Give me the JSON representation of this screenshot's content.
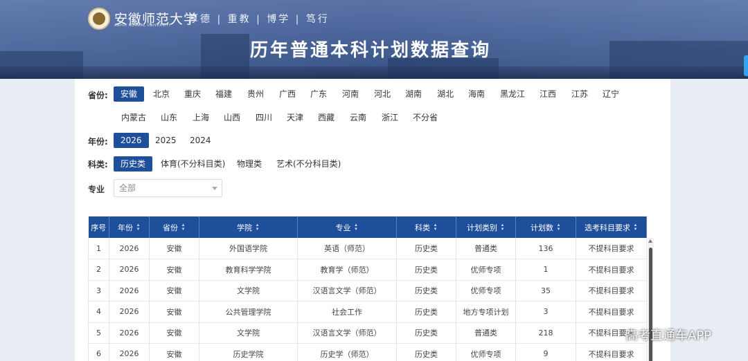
{
  "header": {
    "school_name": "安徽师范大学",
    "school_name_en": "ANHUI NORMAL UNIVERSITY",
    "motto": "厚德 | 重教 | 博学 | 笃行",
    "page_title": "历年普通本科计划数据查询"
  },
  "filters": {
    "province_label": "省份:",
    "provinces_row1": [
      "安徽",
      "北京",
      "重庆",
      "福建",
      "贵州",
      "广西",
      "广东",
      "河南",
      "河北",
      "湖南",
      "湖北",
      "海南",
      "黑龙江",
      "江西",
      "江苏",
      "辽宁"
    ],
    "provinces_row2": [
      "内蒙古",
      "山东",
      "上海",
      "山西",
      "四川",
      "天津",
      "西藏",
      "云南",
      "浙江",
      "不分省"
    ],
    "selected_province": "安徽",
    "year_label": "年份:",
    "years": [
      "2026",
      "2025",
      "2024"
    ],
    "selected_year": "2026",
    "category_label": "科类:",
    "categories": [
      "历史类",
      "体育(不分科目类)",
      "物理类",
      "艺术(不分科目类)"
    ],
    "selected_category": "历史类",
    "major_label": "专业",
    "major_value": "全部"
  },
  "table": {
    "columns": [
      "序号",
      "年份",
      "省份",
      "学院",
      "专业",
      "科类",
      "计划类别",
      "计划数",
      "选考科目要求"
    ],
    "rows": [
      [
        "1",
        "2026",
        "安徽",
        "外国语学院",
        "英语（师范）",
        "历史类",
        "普通类",
        "136",
        "不提科目要求"
      ],
      [
        "2",
        "2026",
        "安徽",
        "教育科学学院",
        "教育学（师范）",
        "历史类",
        "优师专项",
        "1",
        "不提科目要求"
      ],
      [
        "3",
        "2026",
        "安徽",
        "文学院",
        "汉语言文学（师范）",
        "历史类",
        "优师专项",
        "35",
        "不提科目要求"
      ],
      [
        "4",
        "2026",
        "安徽",
        "公共管理学院",
        "社会工作",
        "历史类",
        "地方专项计划",
        "3",
        "不提科目要求"
      ],
      [
        "5",
        "2026",
        "安徽",
        "文学院",
        "汉语言文学（师范）",
        "历史类",
        "普通类",
        "218",
        "不提科目要求"
      ],
      [
        "6",
        "2026",
        "安徽",
        "历史学院",
        "历史学（师范）",
        "历史类",
        "优师专项",
        "9",
        "不提科目要求"
      ]
    ]
  },
  "watermark": "高考直通车APP",
  "colors": {
    "primary": "#1e4f9a",
    "banner": "#4a6398"
  }
}
